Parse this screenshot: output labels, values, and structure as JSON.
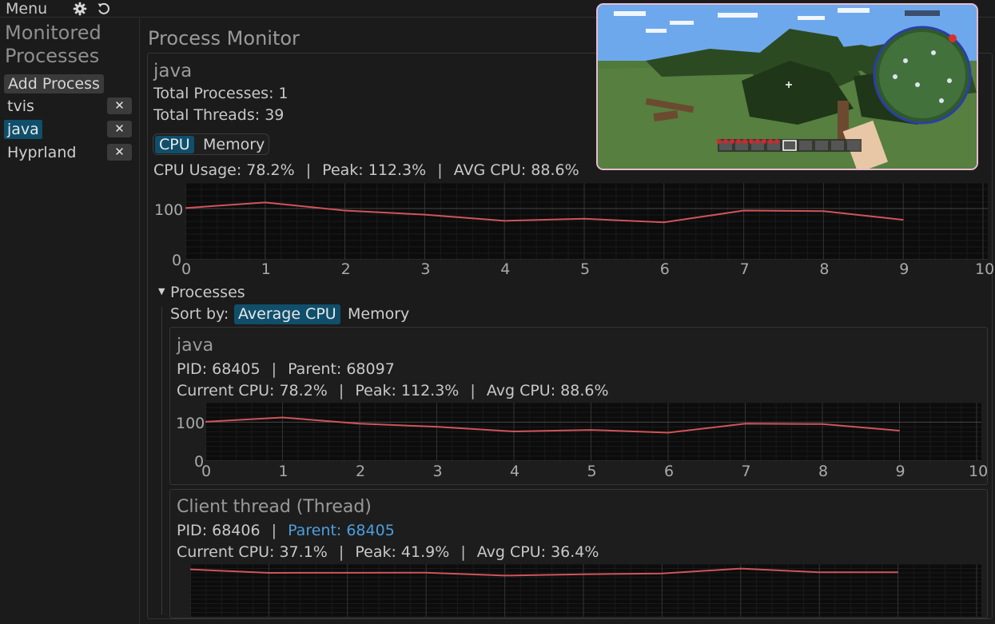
{
  "topbar": {
    "menu_label": "Menu",
    "icons": [
      "gear-icon",
      "refresh-icon"
    ]
  },
  "sidebar": {
    "title": "Monitored Processes",
    "add_label": "Add Process",
    "processes": [
      {
        "name": "tvis",
        "selected": false
      },
      {
        "name": "java",
        "selected": true
      },
      {
        "name": "Hyprland",
        "selected": false
      }
    ],
    "remove_label": "✕"
  },
  "main": {
    "title": "Process Monitor",
    "proc_name": "java",
    "total_processes": "Total Processes: 1",
    "total_threads": "Total Threads: 39",
    "tabs": {
      "cpu": "CPU",
      "memory": "Memory",
      "active": "CPU"
    },
    "stats": {
      "usage": "CPU Usage: 78.2%",
      "peak": "Peak: 112.3%",
      "avg": "AVG CPU: 88.6%",
      "sep": "|"
    },
    "section_label": "Processes",
    "sort_label": "Sort by:",
    "sort_options": {
      "avg_cpu": "Average CPU",
      "memory": "Memory",
      "active": "Average CPU"
    }
  },
  "cards": [
    {
      "title": "java",
      "pid": "PID: 68405",
      "parent": "Parent: 68097",
      "parent_link": false,
      "current": "Current CPU: 78.2%",
      "peak": "Peak: 112.3%",
      "avg": "Avg CPU: 88.6%"
    },
    {
      "title": "Client thread (Thread)",
      "pid": "PID: 68406",
      "parent": "Parent: 68405",
      "parent_link": true,
      "current": "Current CPU: 37.1%",
      "peak": "Peak: 41.9%",
      "avg": "Avg CPU: 36.4%"
    }
  ],
  "colors": {
    "accent": "#0f4f6b",
    "line": "#d0545a",
    "link": "#4a9fe0",
    "overlay_border": "#e6bcd0"
  },
  "chart_data": [
    {
      "type": "line",
      "x": [
        0,
        1,
        2,
        3,
        4,
        5,
        6,
        7,
        8,
        9
      ],
      "series": [
        {
          "values": [
            101,
            112,
            96,
            88,
            76,
            80,
            73,
            96,
            95,
            78
          ]
        }
      ],
      "xlim": [
        0,
        10
      ],
      "ylim": [
        0,
        150
      ],
      "xticks": [
        "0",
        "1",
        "2",
        "3",
        "4",
        "5",
        "6",
        "7",
        "8",
        "9",
        "10"
      ],
      "yticks": [
        "0",
        "100"
      ],
      "grid": true
    },
    {
      "type": "line",
      "x": [
        0,
        1,
        2,
        3,
        4,
        5,
        6,
        7,
        8,
        9
      ],
      "series": [
        {
          "values": [
            101,
            112,
            96,
            88,
            76,
            80,
            73,
            96,
            95,
            78
          ]
        }
      ],
      "xlim": [
        0,
        10
      ],
      "ylim": [
        0,
        150
      ],
      "xticks": [
        "0",
        "1",
        "2",
        "3",
        "4",
        "5",
        "6",
        "7",
        "8",
        "9",
        "10"
      ],
      "yticks": [
        "0",
        "100"
      ],
      "grid": true
    },
    {
      "type": "line",
      "x": [
        0,
        1,
        2,
        3,
        4,
        5,
        6,
        7,
        8,
        9
      ],
      "series": [
        {
          "values": [
            40.5,
            37.5,
            37.6,
            37.7,
            35.2,
            36.3,
            37.0,
            41.2,
            38.0,
            38.0
          ]
        }
      ],
      "xlim": [
        0,
        10
      ],
      "ylim": [
        0,
        45
      ],
      "grid": true
    }
  ]
}
